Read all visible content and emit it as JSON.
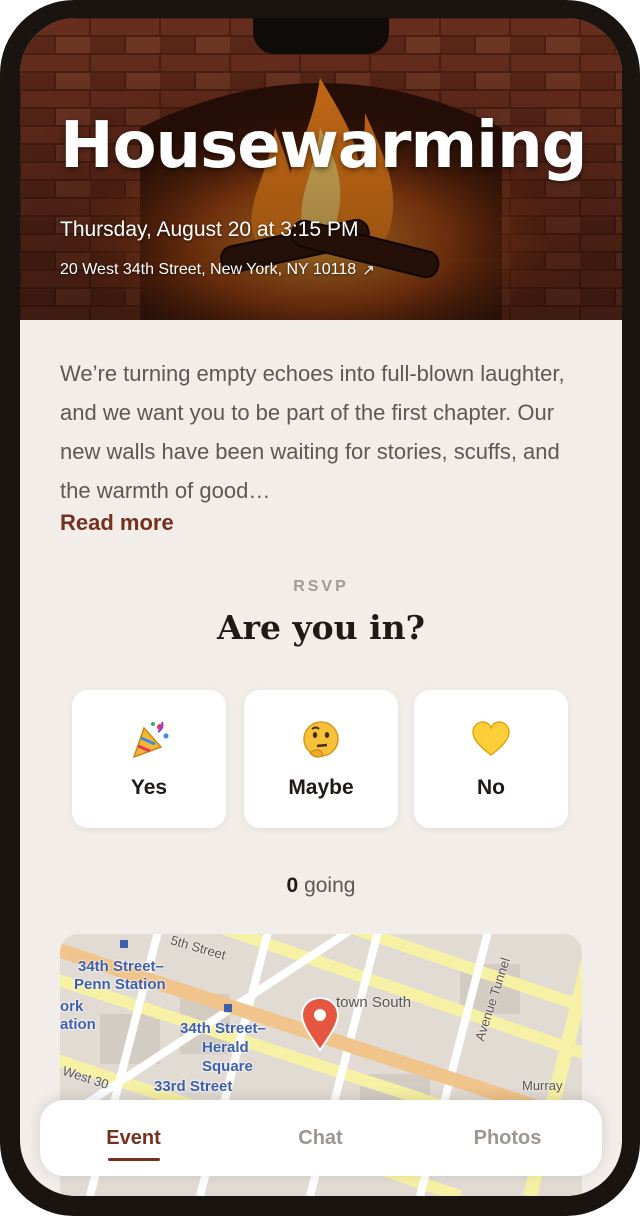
{
  "event": {
    "title": "Housewarming",
    "date": "Thursday, August 20 at 3:15 PM",
    "address": "20 West 34th Street, New York, NY 10118",
    "address_icon": "arrow-up-right-icon"
  },
  "description": {
    "text": "We’re turning empty echoes into full-blown laughter, and we want you to be part of the first chapter. Our new walls have been waiting for stories, scuffs, and the warmth of good…",
    "read_more": "Read more"
  },
  "rsvp": {
    "label": "RSVP",
    "heading": "Are you in?",
    "options": [
      {
        "label": "Yes",
        "icon": "party-popper-icon"
      },
      {
        "label": "Maybe",
        "icon": "thinking-face-icon"
      },
      {
        "label": "No",
        "icon": "yellow-heart-icon"
      }
    ],
    "going_count": "0",
    "going_text": "going"
  },
  "map": {
    "labels": [
      "34th Street–",
      "Penn Station",
      "ork",
      "ation",
      "34th Street–",
      "Herald",
      "Square",
      "33rd Street"
    ],
    "streets": [
      "5th Street",
      "town South",
      "Avenue Tunnel",
      "Murray",
      "West 30"
    ],
    "pin_icon": "map-pin-icon"
  },
  "tabs": [
    "Event",
    "Chat",
    "Photos"
  ],
  "active_tab": "Event",
  "colors": {
    "accent": "#74321e",
    "background": "#f2ede8",
    "muted_text": "#9d9792"
  }
}
